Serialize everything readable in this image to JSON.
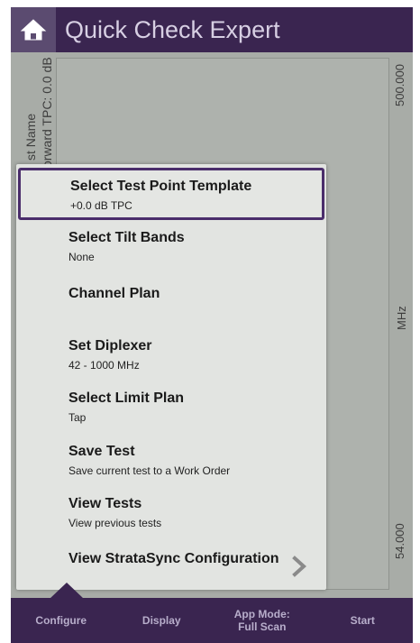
{
  "header": {
    "title": "Quick Check Expert",
    "home_icon": "home-icon"
  },
  "chart": {
    "test_name_label": "st Name",
    "tpc_label": "orward TPC: 0.0 dB",
    "top_value": "500.000",
    "unit": "MHz",
    "bottom_value": "54.000"
  },
  "menu": {
    "items": [
      {
        "title": "Select Test Point Template",
        "subtitle": "+0.0 dB TPC"
      },
      {
        "title": "Select Tilt Bands",
        "subtitle": "None"
      },
      {
        "title": "Channel Plan",
        "subtitle": ""
      },
      {
        "title": "Set Diplexer",
        "subtitle": "42 - 1000 MHz"
      },
      {
        "title": "Select Limit Plan",
        "subtitle": "Tap"
      },
      {
        "title": "Save Test",
        "subtitle": "Save current test to a Work Order"
      },
      {
        "title": "View Tests",
        "subtitle": "View previous tests"
      },
      {
        "title": "View StrataSync Configuration",
        "subtitle": ""
      }
    ]
  },
  "bottom_bar": {
    "configure": "Configure",
    "display": "Display",
    "app_mode_line1": "App Mode:",
    "app_mode_line2": "Full Scan",
    "start": "Start"
  },
  "colors": {
    "header_bg": "#3a2550",
    "selected_border": "#4a2d6b",
    "menu_bg": "#e2e4e1",
    "background": "#a8aca7"
  }
}
